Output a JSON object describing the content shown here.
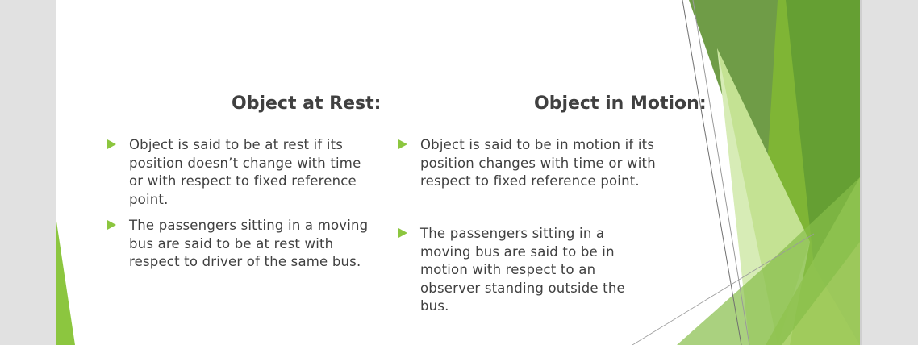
{
  "slide": {
    "left_column": {
      "heading": "Object at Rest:",
      "bullets": [
        "Object is said to be at rest if its position doesn’t change with time or with respect to fixed reference point.",
        "The passengers sitting in a moving bus are said to be at rest with respect to driver of the same bus."
      ]
    },
    "right_column": {
      "heading": "Object in Motion:",
      "bullets": [
        "Object is said to be in motion if its position changes with time or with respect to fixed reference point.",
        "The passengers sitting in a moving bus are said to be in motion with respect to an observer standing outside the bus."
      ]
    }
  },
  "theme": {
    "bullet_color": "#8cc63f",
    "heading_color": "#404040",
    "text_color": "#404040",
    "accent_dark": "#5a9130",
    "accent_light": "#cfe6a9",
    "icons": [
      "triangle-bullet-icon"
    ]
  }
}
